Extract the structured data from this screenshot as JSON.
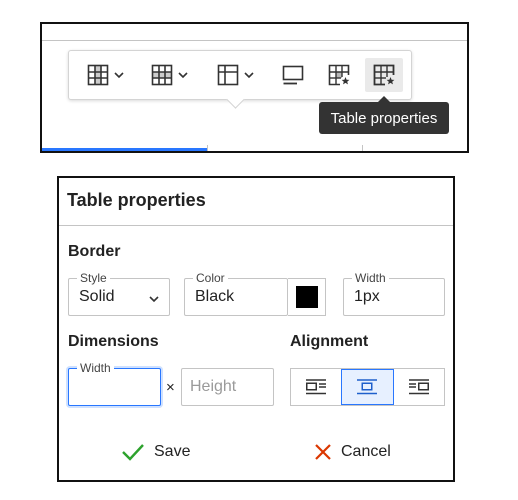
{
  "toolbar": {
    "buttons": [
      {
        "icon": "table-column-icon",
        "has_dropdown": true
      },
      {
        "icon": "table-row-icon",
        "has_dropdown": true
      },
      {
        "icon": "merge-cells-icon",
        "has_dropdown": true
      },
      {
        "icon": "table-caption-icon",
        "has_dropdown": false
      },
      {
        "icon": "cell-properties-icon",
        "has_dropdown": false
      },
      {
        "icon": "table-properties-icon",
        "has_dropdown": false,
        "active": true
      }
    ],
    "tooltip": "Table properties"
  },
  "dialog": {
    "title": "Table properties",
    "border": {
      "label": "Border",
      "style": {
        "label": "Style",
        "value": "Solid"
      },
      "color": {
        "label": "Color",
        "value": "Black",
        "swatch": "#000000"
      },
      "width": {
        "label": "Width",
        "value": "1px"
      }
    },
    "dimensions": {
      "label": "Dimensions",
      "width": {
        "label": "Width",
        "value": ""
      },
      "separator": "×",
      "height": {
        "placeholder": "Height"
      }
    },
    "alignment": {
      "label": "Alignment",
      "options": [
        "align-left-icon",
        "align-center-icon",
        "align-right-icon"
      ],
      "selected": "center"
    },
    "save_label": "Save",
    "cancel_label": "Cancel"
  },
  "colors": {
    "accent": "#2977ff",
    "save": "#2da22d",
    "cancel": "#db3700",
    "tooltip_bg": "#333333"
  }
}
